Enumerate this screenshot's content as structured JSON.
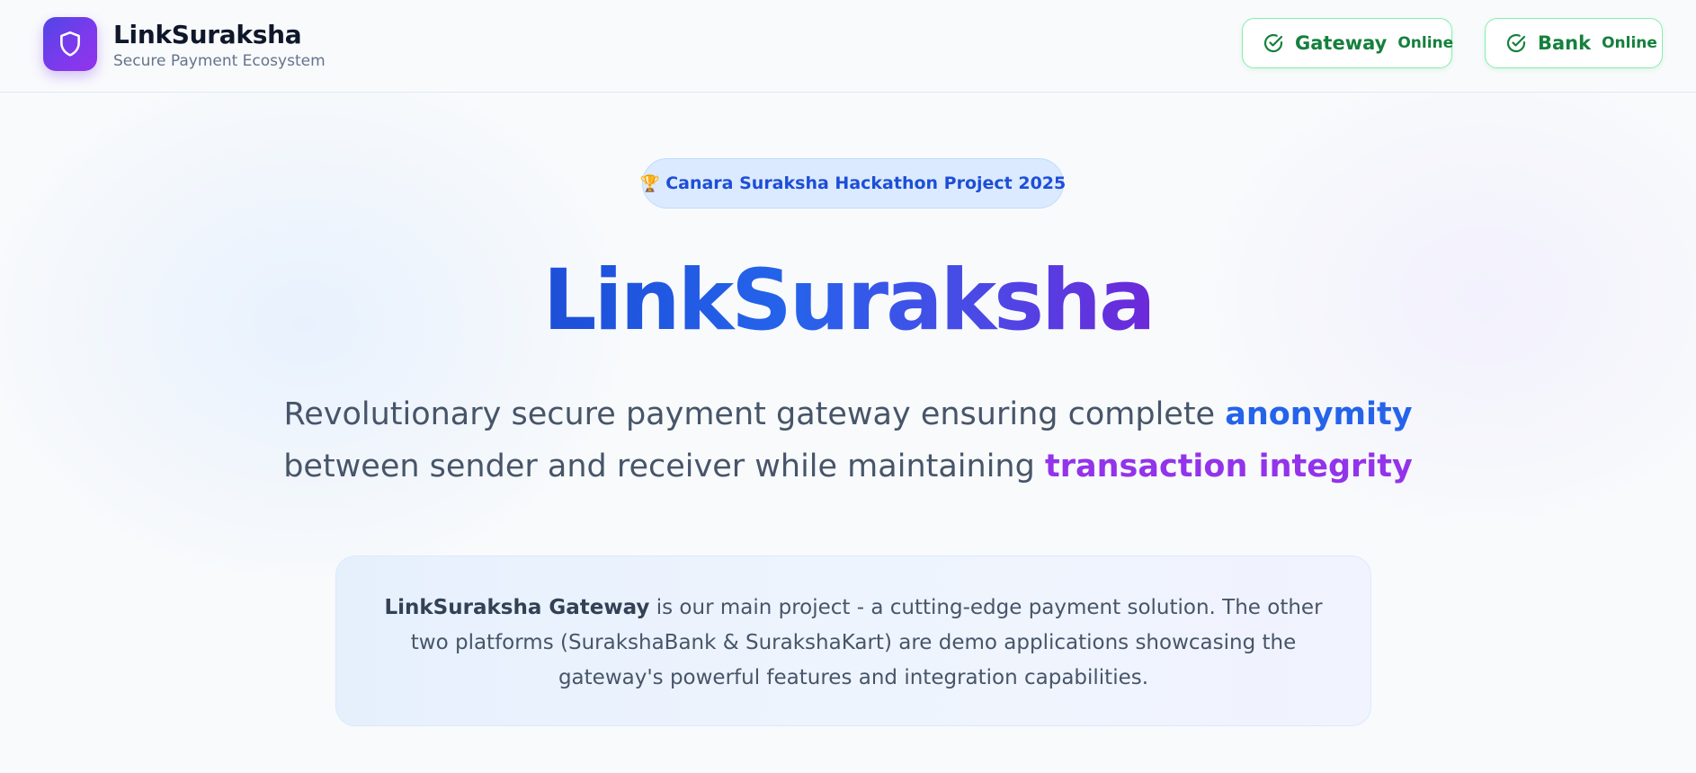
{
  "header": {
    "brand_title": "LinkSuraksha",
    "brand_subtitle": "Secure Payment Ecosystem",
    "logo_icon": "shield-icon",
    "status": [
      {
        "name": "Gateway",
        "state": "Online",
        "icon": "check-circle-icon",
        "color": "#15803d"
      },
      {
        "name": "Bank",
        "state": "Online",
        "icon": "check-circle-icon",
        "color": "#15803d"
      }
    ]
  },
  "hero": {
    "badge_icon": "🏆",
    "badge_text": "Canara Suraksha Hackathon Project 2025",
    "title": "LinkSuraksha",
    "tagline": {
      "part1": "Revolutionary secure payment gateway ensuring complete ",
      "highlight1": "anonymity",
      "part2": " between sender and receiver while maintaining ",
      "highlight2": "transaction integrity"
    },
    "info": {
      "strong": "LinkSuraksha Gateway",
      "text": " is our main project - a cutting-edge payment solution. The other two platforms (SurakshaBank & SurakshaKart) are demo applications showcasing the gateway's powerful features and integration capabilities."
    }
  },
  "colors": {
    "accent_blue": "#2563eb",
    "accent_purple": "#9333ea",
    "status_green": "#15803d",
    "logo_gradient_start": "#4f46e5",
    "logo_gradient_end": "#9333ea"
  }
}
